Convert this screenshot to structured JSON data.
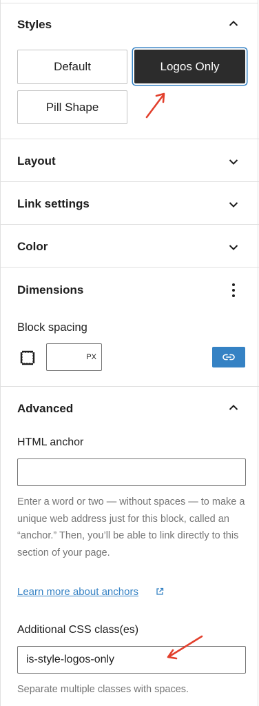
{
  "panels": {
    "styles": {
      "title": "Styles",
      "expanded": true
    },
    "layout": {
      "title": "Layout",
      "expanded": false
    },
    "link_settings": {
      "title": "Link settings",
      "expanded": false
    },
    "color": {
      "title": "Color",
      "expanded": false
    },
    "dimensions": {
      "title": "Dimensions"
    },
    "advanced": {
      "title": "Advanced",
      "expanded": true
    }
  },
  "styles": {
    "options": [
      "Default",
      "Logos Only",
      "Pill Shape"
    ],
    "selected": "Logos Only"
  },
  "dimensions": {
    "block_spacing_label": "Block spacing",
    "unit": "PX",
    "value": ""
  },
  "advanced": {
    "html_anchor_label": "HTML anchor",
    "html_anchor_value": "",
    "anchor_help": "Enter a word or two — without spaces — to make a unique web address just for this block, called an “anchor.” Then, you’ll be able to link directly to this section of your page.",
    "learn_more_link": "Learn more about anchors",
    "css_class_label": "Additional CSS class(es)",
    "css_class_value": "is-style-logos-only",
    "css_class_help": "Separate multiple classes with spaces."
  },
  "colors": {
    "accent": "#3582c4",
    "annotation_arrow": "#e2402d",
    "selected_bg": "#2c2c2c"
  }
}
